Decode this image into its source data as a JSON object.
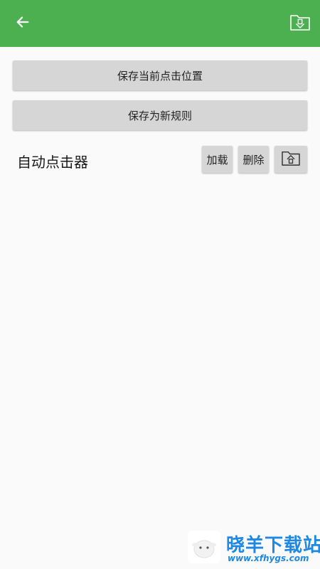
{
  "app": {
    "colors": {
      "appbar": "#4caf50",
      "background": "#fafafa",
      "button": "#d6d6d6",
      "watermark": "#1e88e5"
    },
    "icons": {
      "back": "arrow-left-icon",
      "import": "folder-download-icon",
      "export": "folder-upload-icon"
    }
  },
  "actions": {
    "save_position_label": "保存当前点击位置",
    "save_rule_label": "保存为新规则"
  },
  "rule": {
    "name": "自动点击器",
    "load_label": "加载",
    "delete_label": "删除"
  },
  "watermark": {
    "site_name": "晓羊下载站",
    "url": "www.xfhygs.com"
  }
}
